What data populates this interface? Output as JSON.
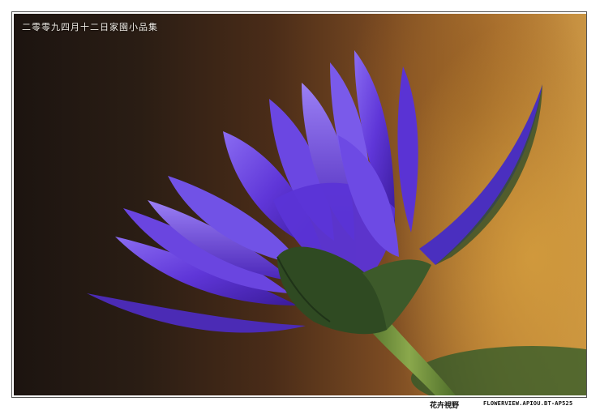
{
  "photo": {
    "caption": "二零零九四月十二日家園小品集",
    "subject": "purple water lily bud",
    "colors": {
      "petal": "#6a3fe0",
      "petal_dark": "#3f1fa8",
      "sepal": "#2f4a22",
      "stem": "#6f8f3a",
      "leaf": "#2f5a2a"
    }
  },
  "footer": {
    "site_name": "花卉視野",
    "site_url": "FLOWERVIEW.APIOU.BT-AP525"
  }
}
